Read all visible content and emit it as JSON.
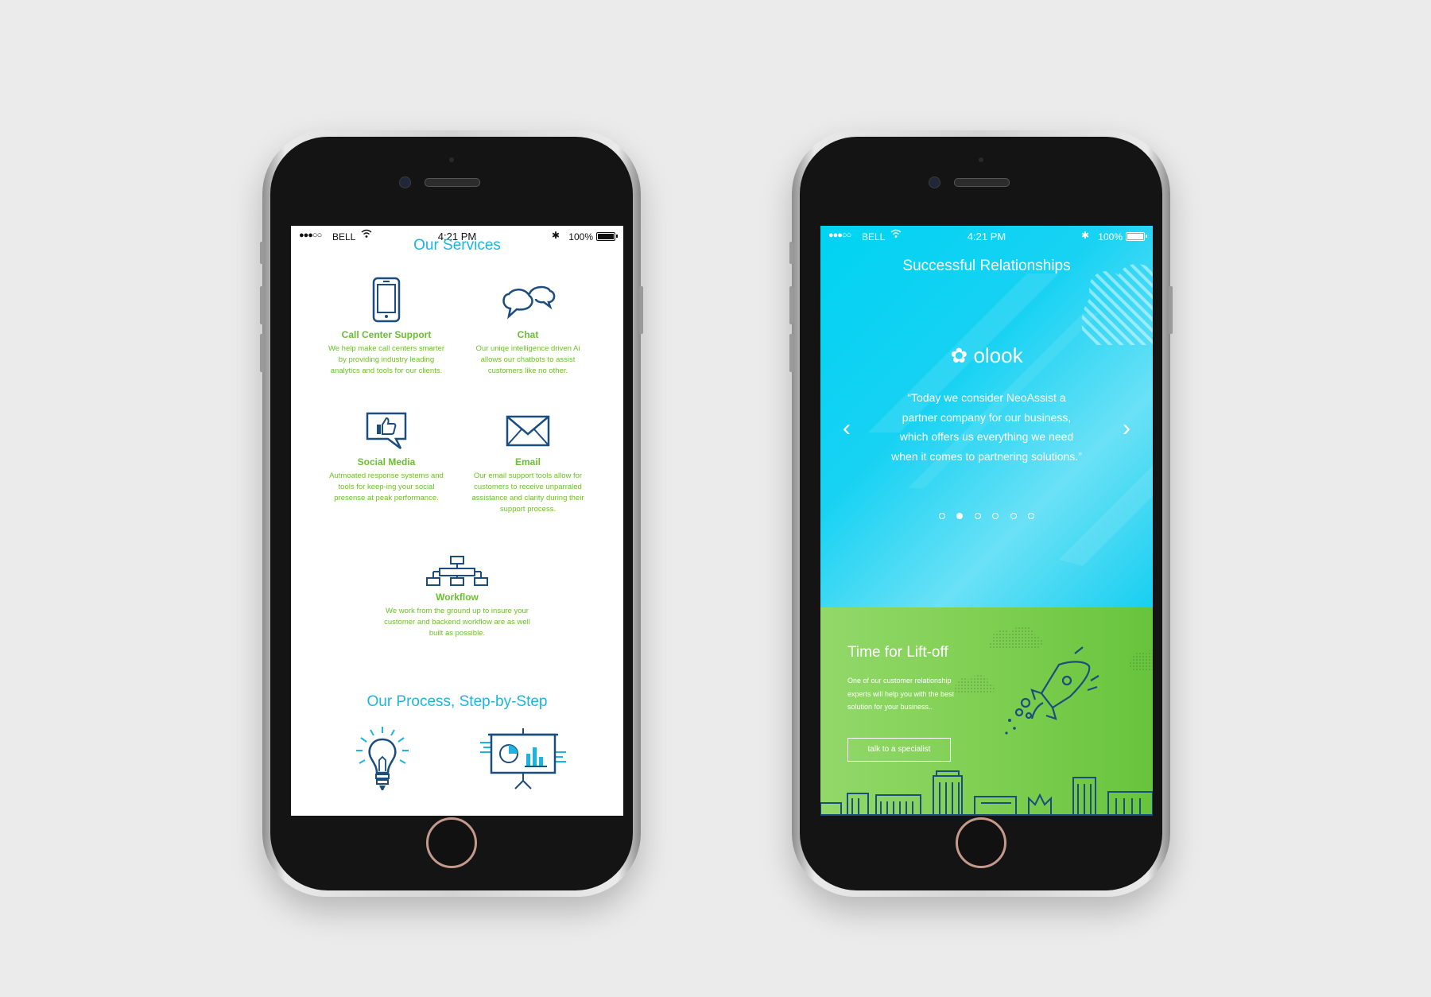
{
  "colors": {
    "background": "#ebebeb",
    "accent_blue": "#1cb5e0",
    "accent_green": "#6bbf2e",
    "icon_navy": "#1b4d7e"
  },
  "status_bar": {
    "signal": "●●●○○",
    "carrier": "BELL",
    "time": "4:21 PM",
    "battery": "100%"
  },
  "left_screen": {
    "services_title": "Our Services",
    "services": [
      {
        "icon": "phone-icon",
        "title": "Call Center Support",
        "description": "We help make call centers smarter by providing industry leading analytics and tools for our clients."
      },
      {
        "icon": "chat-bubbles-icon",
        "title": "Chat",
        "description": "Our uniqe intelligence driven Ai allows our chatbots to assist customers like no other."
      },
      {
        "icon": "thumbs-up-icon",
        "title": "Social Media",
        "description": "Autmoated response systems and tools for keep-ing your social presense at peak performance."
      },
      {
        "icon": "envelope-icon",
        "title": "Email",
        "description": "Our email support tools allow for customers to receive unparraled assistance and clarity during their support process."
      },
      {
        "icon": "workflow-icon",
        "title": "Workflow",
        "description": "We work from the ground up to insure your customer and backend workflow are as well built as possible."
      }
    ],
    "process_title": "Our Process, Step-by-Step",
    "process_icons": [
      "lightbulb-icon",
      "presentation-board-icon"
    ]
  },
  "right_screen": {
    "relationships_title": "Successful Relationships",
    "logo_text": "olook",
    "quote": "“Today we consider NeoAssist a partner company for our business, which offers us everything we need when it comes to partnering solutions.”",
    "carousel": {
      "total": 6,
      "active": 1,
      "prev": "‹",
      "next": "›"
    },
    "liftoff_title": "Time for Lift-off",
    "liftoff_description": "One of our customer relationship experts will help you with the best solution for your business..",
    "cta_label": "talk to a specialist"
  }
}
